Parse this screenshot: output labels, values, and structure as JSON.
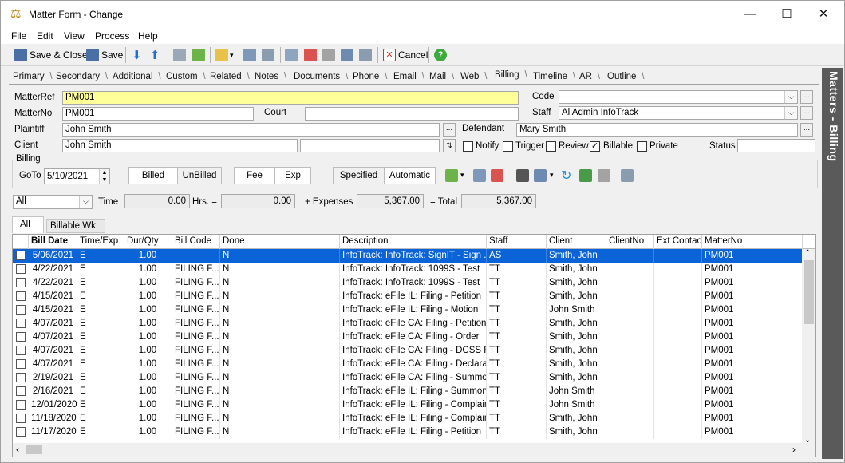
{
  "window": {
    "title": "Matter Form - Change"
  },
  "menu": [
    "File",
    "Edit",
    "View",
    "Process",
    "Help"
  ],
  "toolbar": {
    "save_close": "Save & Close",
    "save": "Save",
    "cancel": "Cancel"
  },
  "tabs": [
    "Primary",
    "Secondary",
    "Additional",
    "Custom",
    "Related",
    "Notes",
    "Documents",
    "Phone",
    "Email",
    "Mail",
    "Web",
    "Billing",
    "Timeline",
    "AR",
    "Outline"
  ],
  "active_tab": "Billing",
  "side_panel": "Matters - Billing",
  "form": {
    "matterref_label": "MatterRef",
    "matterref": "PM001",
    "code_label": "Code",
    "code": "",
    "matterno_label": "MatterNo",
    "matterno": "PM001",
    "court_label": "Court",
    "court": "",
    "staff_label": "Staff",
    "staff": "AllAdmin InfoTrack",
    "plaintiff_label": "Plaintiff",
    "plaintiff": "John Smith",
    "defendant_label": "Defendant",
    "defendant": "Mary Smith",
    "client_label": "Client",
    "client": "John Smith",
    "client2": "",
    "notify": "Notify",
    "trigger": "Trigger",
    "review": "Review",
    "billable": "Billable",
    "private": "Private",
    "billable_checked": true,
    "status_label": "Status",
    "status": ""
  },
  "billing": {
    "group_label": "Billing",
    "goto_label": "GoTo",
    "goto_date": "5/10/2021",
    "billed": "Billed",
    "unbilled": "UnBilled",
    "fee": "Fee",
    "exp": "Exp",
    "specified": "Specified",
    "automatic": "Automatic"
  },
  "totals": {
    "filter": "All",
    "time_label": "Time",
    "time": "0.00",
    "hrs_label": "Hrs. =",
    "hrs": "0.00",
    "expenses_label": "+ Expenses",
    "expenses": "5,367.00",
    "total_label": "= Total",
    "total": "5,367.00"
  },
  "subtabs": [
    "All",
    "Billable Wk"
  ],
  "grid": {
    "columns": [
      "Bill Date",
      "Time/Exp",
      "Dur/Qty",
      "Bill Code",
      "Done",
      "Description",
      "Staff",
      "Client",
      "ClientNo",
      "Ext Contact",
      "MatterNo"
    ],
    "rows": [
      [
        "5/06/2021",
        "E",
        "1.00",
        "",
        "N",
        "InfoTrack: InfoTrack: SignIT - Sign ...",
        "AS",
        "Smith, John",
        "",
        "",
        "PM001"
      ],
      [
        "4/22/2021",
        "E",
        "1.00",
        "FILING F...",
        "N",
        "InfoTrack: InfoTrack: 1099S - Test",
        "TT",
        "Smith, John",
        "",
        "",
        "PM001"
      ],
      [
        "4/22/2021",
        "E",
        "1.00",
        "FILING F...",
        "N",
        "InfoTrack: InfoTrack: 1099S - Test",
        "TT",
        "Smith, John",
        "",
        "",
        "PM001"
      ],
      [
        "4/15/2021",
        "E",
        "1.00",
        "FILING F...",
        "N",
        "InfoTrack: eFile IL: Filing - Petition",
        "TT",
        "Smith, John",
        "",
        "",
        "PM001"
      ],
      [
        "4/15/2021",
        "E",
        "1.00",
        "FILING F...",
        "N",
        "InfoTrack: eFile IL: Filing - Motion",
        "TT",
        "John Smith",
        "",
        "",
        "PM001"
      ],
      [
        "4/07/2021",
        "E",
        "1.00",
        "FILING F...",
        "N",
        "InfoTrack: eFile CA: Filing - Petition:...",
        "TT",
        "Smith, John",
        "",
        "",
        "PM001"
      ],
      [
        "4/07/2021",
        "E",
        "1.00",
        "FILING F...",
        "N",
        "InfoTrack: eFile CA: Filing - Order",
        "TT",
        "Smith, John",
        "",
        "",
        "PM001"
      ],
      [
        "4/07/2021",
        "E",
        "1.00",
        "FILING F...",
        "N",
        "InfoTrack: eFile CA: Filing - DCSS F...",
        "TT",
        "Smith, John",
        "",
        "",
        "PM001"
      ],
      [
        "4/07/2021",
        "E",
        "1.00",
        "FILING F...",
        "N",
        "InfoTrack: eFile CA: Filing - Declara...",
        "TT",
        "Smith, John",
        "",
        "",
        "PM001"
      ],
      [
        "2/19/2021",
        "E",
        "1.00",
        "FILING F...",
        "N",
        "InfoTrack: eFile CA: Filing - Summons",
        "TT",
        "Smith, John",
        "",
        "",
        "PM001"
      ],
      [
        "2/16/2021",
        "E",
        "1.00",
        "FILING F...",
        "N",
        "InfoTrack: eFile IL: Filing - Summon...",
        "TT",
        "John Smith",
        "",
        "",
        "PM001"
      ],
      [
        "12/01/2020",
        "E",
        "1.00",
        "FILING F...",
        "N",
        "InfoTrack: eFile IL: Filing - Complaint",
        "TT",
        "John Smith",
        "",
        "",
        "PM001"
      ],
      [
        "11/18/2020",
        "E",
        "1.00",
        "FILING F...",
        "N",
        "InfoTrack: eFile IL: Filing - Complaint",
        "TT",
        "Smith, John",
        "",
        "",
        "PM001"
      ],
      [
        "11/17/2020",
        "E",
        "1.00",
        "FILING F...",
        "N",
        "InfoTrack: eFile IL: Filing - Petition",
        "TT",
        "Smith, John",
        "",
        "",
        "PM001"
      ]
    ]
  }
}
